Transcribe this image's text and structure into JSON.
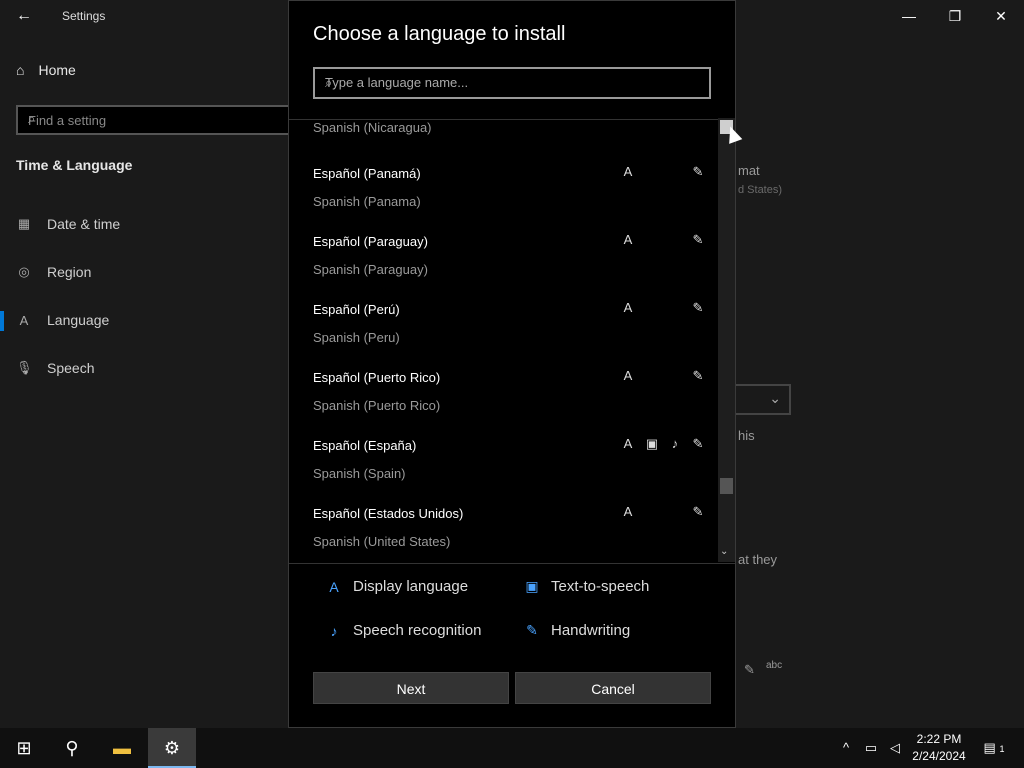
{
  "settings": {
    "window_title": "Settings",
    "home_label": "Home",
    "find_placeholder": "Find a setting",
    "section_title": "Time & Language",
    "nav_items": [
      {
        "label": "Date & time",
        "icon": "calendar-clock-icon"
      },
      {
        "label": "Region",
        "icon": "globe-icon"
      },
      {
        "label": "Language",
        "icon": "language-icon"
      },
      {
        "label": "Speech",
        "icon": "microphone-icon"
      }
    ],
    "bg_fragments": {
      "format": "mat",
      "states": "d States)",
      "this": "his",
      "they": "at they"
    }
  },
  "dialog": {
    "title": "Choose a language to install",
    "search_placeholder": "Type a language name...",
    "partial_item": "Spanish (Nicaragua)",
    "languages": [
      {
        "native": "Español (Panamá)",
        "english": "Spanish (Panama)",
        "features": [
          "display",
          "handwriting"
        ]
      },
      {
        "native": "Español (Paraguay)",
        "english": "Spanish (Paraguay)",
        "features": [
          "display",
          "handwriting"
        ]
      },
      {
        "native": "Español (Perú)",
        "english": "Spanish (Peru)",
        "features": [
          "display",
          "handwriting"
        ]
      },
      {
        "native": "Español (Puerto Rico)",
        "english": "Spanish (Puerto Rico)",
        "features": [
          "display",
          "handwriting"
        ]
      },
      {
        "native": "Español (España)",
        "english": "Spanish (Spain)",
        "features": [
          "display",
          "tts",
          "speech",
          "handwriting"
        ]
      },
      {
        "native": "Español (Estados Unidos)",
        "english": "Spanish (United States)",
        "features": [
          "display",
          "handwriting"
        ]
      }
    ],
    "legend": {
      "display": "Display language",
      "tts": "Text-to-speech",
      "speech": "Speech recognition",
      "handwriting": "Handwriting"
    },
    "next_label": "Next",
    "cancel_label": "Cancel"
  },
  "taskbar": {
    "time": "2:22 PM",
    "date": "2/24/2024",
    "notification_count": "1"
  },
  "colors": {
    "accent": "#0078d7",
    "legend_icon": "#4aa3ff"
  }
}
